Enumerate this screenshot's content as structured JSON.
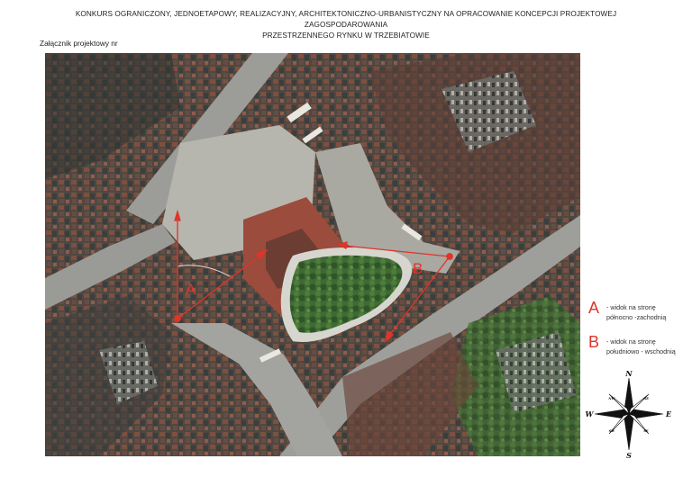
{
  "header": {
    "line1": "KONKURS OGRANICZONY, JEDNOETAPOWY, REALIZACYJNY, ARCHITEKTONICZNO-URBANISTYCZNY NA OPRACOWANIE KONCEPCJI PROJEKTOWEJ ZAGOSPODAROWANIA",
    "line2": "PRZESTRZENNEGO RYNKU W TRZEBIATOWIE"
  },
  "annex_label": "Załącznik projektowy nr",
  "map": {
    "marker_a": "A",
    "marker_b": "B",
    "arrow_color": "#e0342a"
  },
  "legend": [
    {
      "letter": "A",
      "text_line1": "- widok na stronę",
      "text_line2": "północno -zachodnią"
    },
    {
      "letter": "B",
      "text_line1": "- widok na stronę",
      "text_line2": "południowo - wschodnią"
    }
  ],
  "compass": {
    "n": "N",
    "s": "S",
    "e": "E",
    "w": "W",
    "nw": "NW",
    "ne": "NE",
    "sw": "SW",
    "se": "SE"
  }
}
